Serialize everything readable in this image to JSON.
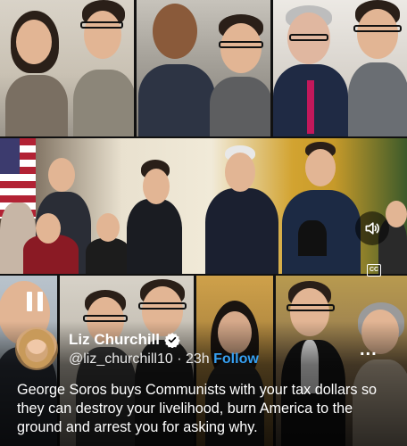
{
  "post": {
    "author_name": "Liz Churchill",
    "handle": "@liz_churchill10",
    "separator": "·",
    "time_ago": "23h",
    "follow_label": "Follow",
    "more_label": "...",
    "caption": "George Soros buys Communists with your tax dollars so they can destroy your livelihood, burn America to the ground and arrest you for asking why."
  },
  "video": {
    "state": "playing",
    "captions_label": "CC"
  },
  "icons": {
    "verified": "verified-badge-icon",
    "speaker": "speaker-volume-icon",
    "captions": "closed-captions-icon",
    "pause": "pause-icon"
  },
  "colors": {
    "follow": "#35a0f2",
    "verified": "#1d9bf0",
    "text": "#ffffff"
  }
}
